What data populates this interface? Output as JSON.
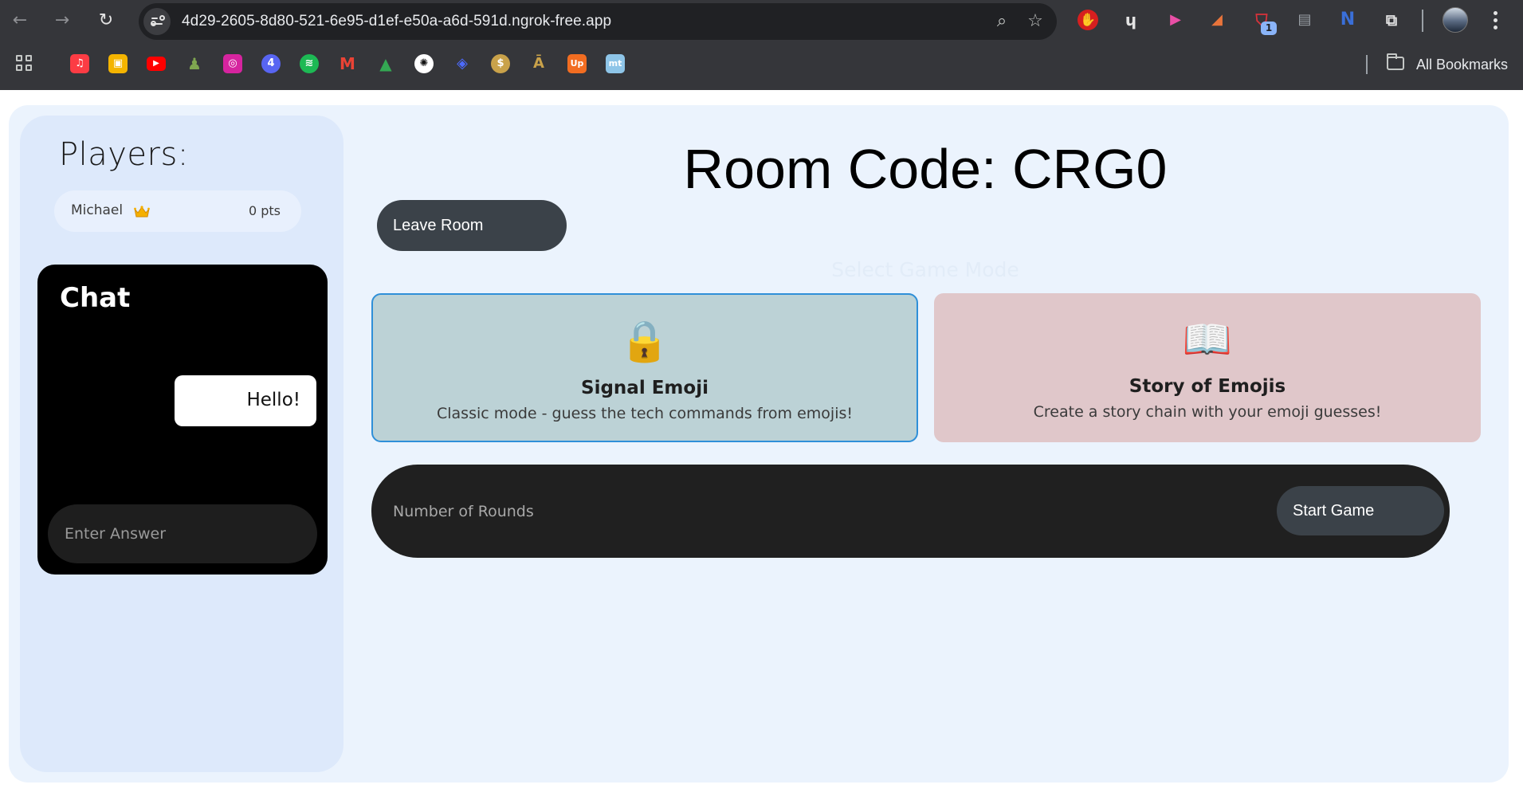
{
  "browser": {
    "url": "4d29-2605-8d80-521-6e95-d1ef-e50a-a6d-591d.ngrok-free.app",
    "extension_badge_count": "1",
    "bookmarks_label": "All Bookmarks"
  },
  "sidebar": {
    "players_title": "Players:",
    "players": [
      {
        "name": "Michael",
        "points": "0 pts",
        "is_host": true
      }
    ],
    "chat": {
      "title": "Chat",
      "messages": [
        "Hello!"
      ],
      "input_placeholder": "Enter Answer"
    }
  },
  "main": {
    "room_code_heading": "Room Code: CRG0",
    "leave_button": "Leave Room",
    "select_mode_label": "Select Game Mode",
    "modes": [
      {
        "icon": "lock-icon",
        "emoji": "🔒",
        "title": "Signal Emoji",
        "description": "Classic mode - guess the tech commands from emojis!",
        "selected": true,
        "color": "#bcd2d6"
      },
      {
        "icon": "book-icon",
        "emoji": "📖",
        "title": "Story of Emojis",
        "description": "Create a story chain with your emoji guesses!",
        "selected": false,
        "color": "#e0c7ca"
      }
    ],
    "rounds_placeholder": "Number of Rounds",
    "start_button": "Start Game"
  },
  "colors": {
    "accent": "#2f8fd8",
    "button_dark": "#3b4249",
    "page_background": "#ebf3fd"
  }
}
